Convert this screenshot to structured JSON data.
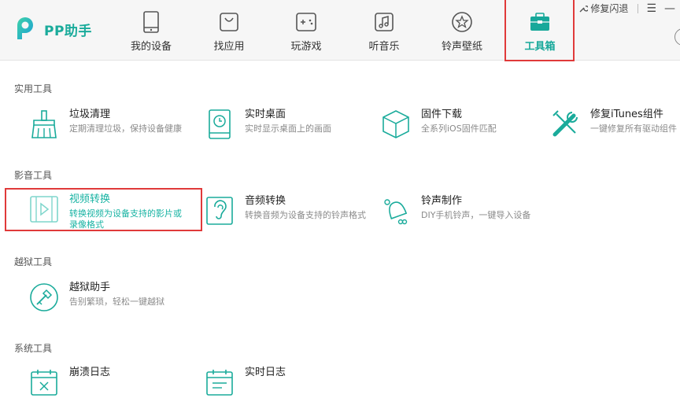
{
  "app": {
    "title": "PP助手"
  },
  "nav": [
    {
      "label": "我的设备",
      "icon": "phone-icon"
    },
    {
      "label": "找应用",
      "icon": "bag-icon"
    },
    {
      "label": "玩游戏",
      "icon": "gamepad-icon"
    },
    {
      "label": "听音乐",
      "icon": "music-icon"
    },
    {
      "label": "铃声壁纸",
      "icon": "star-icon"
    },
    {
      "label": "工具箱",
      "icon": "toolbox-icon",
      "active": true
    }
  ],
  "window": {
    "flash_fix": "修复闪退"
  },
  "sections": [
    {
      "title": "实用工具",
      "tools": [
        {
          "name": "垃圾清理",
          "desc": "定期清理垃圾，保持设备健康"
        },
        {
          "name": "实时桌面",
          "desc": "实时显示桌面上的画面"
        },
        {
          "name": "固件下载",
          "desc": "全系列iOS固件匹配"
        },
        {
          "name": "修复iTunes组件",
          "desc": "一键修复所有驱动组件"
        }
      ]
    },
    {
      "title": "影音工具",
      "tools": [
        {
          "name": "视频转换",
          "desc": "转换视频为设备支持的影片或录像格式"
        },
        {
          "name": "音频转换",
          "desc": "转换音频为设备支持的铃声格式"
        },
        {
          "name": "铃声制作",
          "desc": "DIY手机铃声，一键导入设备"
        }
      ]
    },
    {
      "title": "越狱工具",
      "tools": [
        {
          "name": "越狱助手",
          "desc": "告别繁琐，轻松一键越狱"
        }
      ]
    },
    {
      "title": "系统工具",
      "tools": [
        {
          "name": "崩溃日志",
          "desc": ""
        },
        {
          "name": "实时日志",
          "desc": ""
        }
      ]
    }
  ],
  "colors": {
    "accent": "#17a89a",
    "highlight_border": "#e03a3a",
    "icon_stroke": "#1aab9b"
  }
}
